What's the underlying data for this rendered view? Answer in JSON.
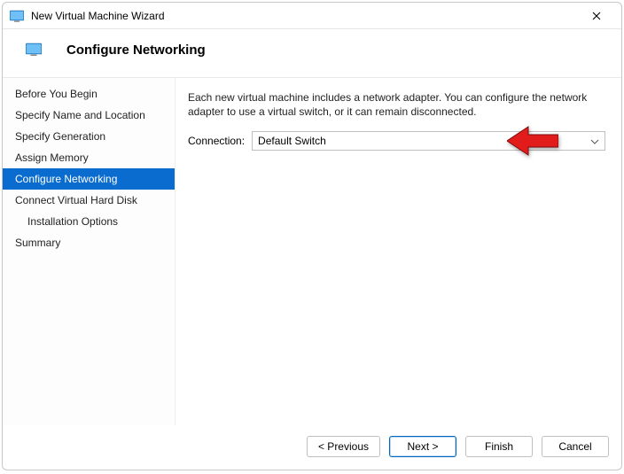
{
  "window": {
    "title": "New Virtual Machine Wizard"
  },
  "header": {
    "title": "Configure Networking"
  },
  "sidebar": {
    "items": [
      {
        "label": "Before You Begin"
      },
      {
        "label": "Specify Name and Location"
      },
      {
        "label": "Specify Generation"
      },
      {
        "label": "Assign Memory"
      },
      {
        "label": "Configure Networking"
      },
      {
        "label": "Connect Virtual Hard Disk"
      },
      {
        "label": "Installation Options"
      },
      {
        "label": "Summary"
      }
    ],
    "active_index": 4
  },
  "content": {
    "description": "Each new virtual machine includes a network adapter. You can configure the network adapter to use a virtual switch, or it can remain disconnected.",
    "connection_label": "Connection:",
    "connection_value": "Default Switch"
  },
  "footer": {
    "previous": "< Previous",
    "next": "Next >",
    "finish": "Finish",
    "cancel": "Cancel"
  }
}
